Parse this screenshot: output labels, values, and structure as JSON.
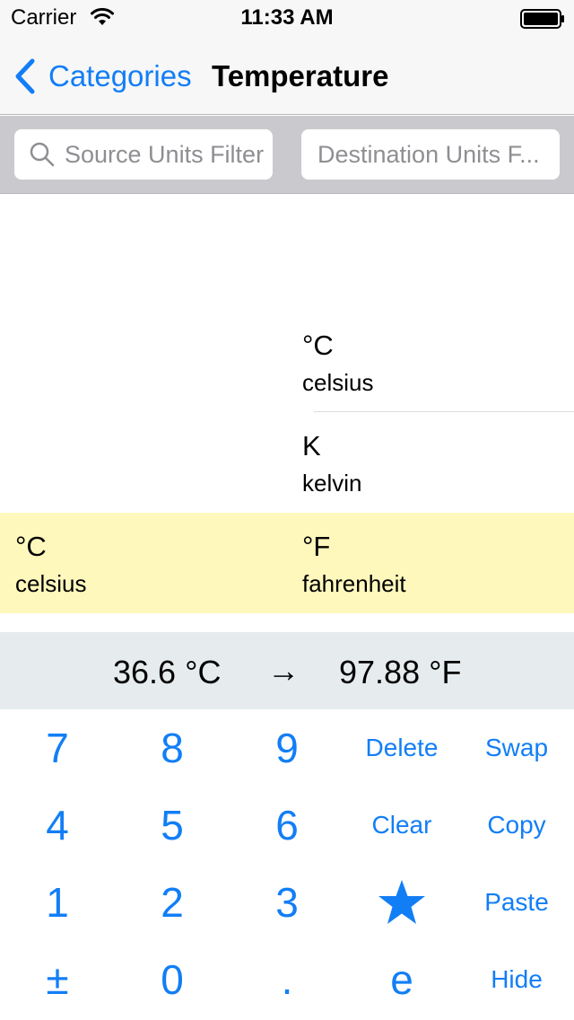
{
  "status_bar": {
    "carrier": "Carrier",
    "time": "11:33 AM"
  },
  "nav": {
    "back_label": "Categories",
    "title": "Temperature"
  },
  "filters": {
    "source_placeholder": "Source Units Filter",
    "destination_placeholder": "Destination Units F..."
  },
  "destination_units": [
    {
      "symbol": "°C",
      "name": "celsius"
    },
    {
      "symbol": "K",
      "name": "kelvin"
    },
    {
      "symbol": "°F",
      "name": "fahrenheit"
    }
  ],
  "source_units": [
    {
      "symbol": "°C",
      "name": "celsius"
    }
  ],
  "conversion": {
    "source": "36.6 °C",
    "arrow": "→",
    "result": "97.88 °F"
  },
  "keypad": {
    "row1": [
      "7",
      "8",
      "9",
      "Delete",
      "Swap"
    ],
    "row2": [
      "4",
      "5",
      "6",
      "Clear",
      "Copy"
    ],
    "row3": [
      "1",
      "2",
      "3",
      "star-icon",
      "Paste"
    ],
    "row4": [
      "±",
      "0",
      ".",
      "e",
      "Hide"
    ]
  },
  "colors": {
    "accent": "#127ef6",
    "selected_row": "#fff8bd",
    "conversion_bar": "#e6eced",
    "filter_bar": "#c9c9ce"
  },
  "icons": {
    "wifi": "wifi-icon",
    "battery": "battery-icon",
    "back": "chevron-left-icon",
    "search": "search-icon",
    "favorite": "star-icon"
  }
}
